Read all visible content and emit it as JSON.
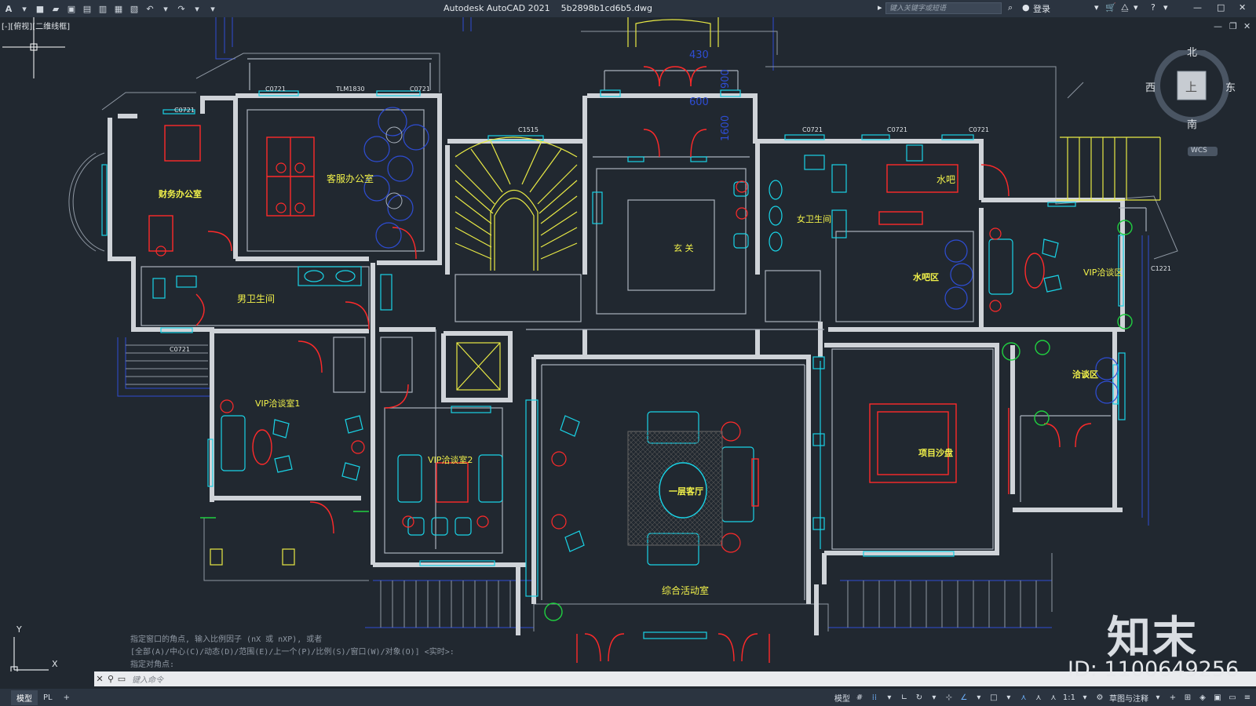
{
  "app": {
    "title": "Autodesk AutoCAD 2021",
    "file": "5b2898b1cd6b5.dwg",
    "search_placeholder": "键入关键字或短语",
    "login": "登录"
  },
  "viewport": {
    "label": "[-][俯视][二维线框]"
  },
  "viewcube": {
    "north": "北",
    "south": "南",
    "west": "西",
    "east": "东",
    "top": "上",
    "wcs": "WCS"
  },
  "ucs": {
    "x": "X",
    "y": "Y"
  },
  "rooms": {
    "finance": "财务办公室",
    "service": "客服办公室",
    "mens": "男卫生间",
    "foyer": "玄 关",
    "womens": "女卫生间",
    "bar": "水吧",
    "bar_area": "水吧区",
    "vip_area": "VIP洽谈区",
    "negotiation": "洽谈区",
    "vip1": "VIP洽谈室1",
    "vip2": "VIP洽谈室2",
    "living": "一层客厅",
    "activity": "综合活动室",
    "sandtable": "项目沙盘"
  },
  "tags": {
    "c0721a": "C0721",
    "c0721b": "C0721",
    "tlm": "TLM1830",
    "c0721c": "C0721",
    "c1515": "C1515",
    "c0721d": "C0721",
    "c0721e": "C0721",
    "c0721f": "C0721",
    "c0721g": "C0721",
    "dim430": "430",
    "dim900": "900",
    "dim600": "600",
    "dim1600": "1600",
    "c1221": "C1221"
  },
  "command": {
    "line1": "指定窗口的角点, 输入比例因子 (nX 或 nXP), 或者",
    "line2": "[全部(A)/中心(C)/动态(D)/范围(E)/上一个(P)/比例(S)/窗口(W)/对象(O)] <实时>:",
    "line3": "指定对角点:",
    "input_placeholder": "键入命令"
  },
  "status": {
    "tab_model": "模型",
    "tab_layout": "PL",
    "add": "+",
    "model": "模型",
    "scale": "1:1",
    "workspace": "草图与注释"
  },
  "watermark": {
    "brand": "知末",
    "id": "ID: 1100649256"
  },
  "colors": {
    "wall": "#d9d9d9",
    "cyan": "#19d3e6",
    "red": "#ff2a2a",
    "yellow": "#f2f24a",
    "blue": "#3a4fd9",
    "green": "#20d040",
    "bg": "#212830"
  }
}
